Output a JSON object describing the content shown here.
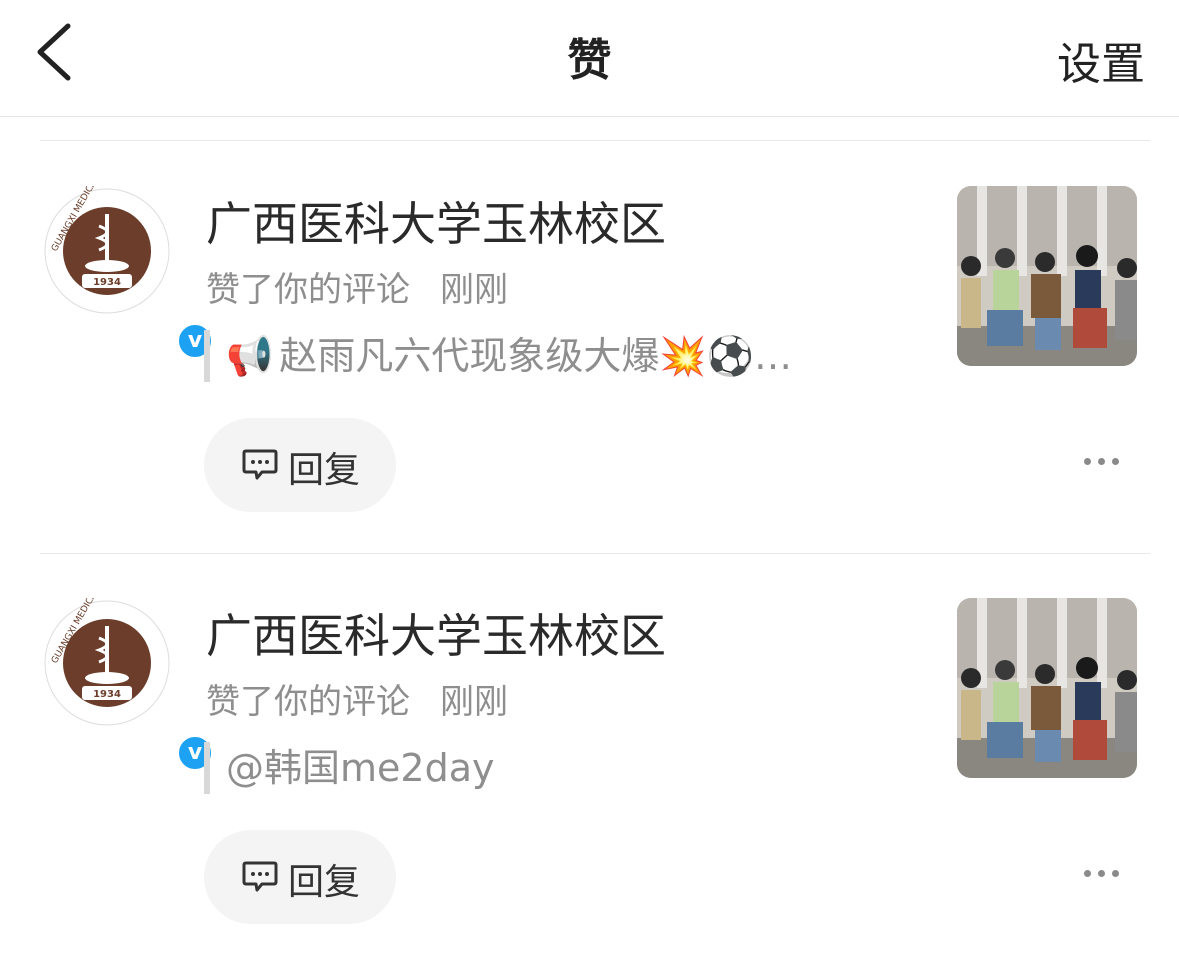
{
  "header": {
    "title": "赞",
    "settings_label": "设置"
  },
  "notifications": [
    {
      "user_name": "广西医科大学玉林校区",
      "avatar_year": "1934",
      "action": "赞了你的评论",
      "time": "刚刚",
      "quote_icon": "📢",
      "quote_text": "赵雨凡六代现象级大爆💥⚽…",
      "reply_label": "回复"
    },
    {
      "user_name": "广西医科大学玉林校区",
      "avatar_year": "1934",
      "action": "赞了你的评论",
      "time": "刚刚",
      "quote_icon": "",
      "quote_text": "@韩国me2day",
      "reply_label": "回复"
    }
  ],
  "colors": {
    "verified_badge": "#1da1f2",
    "avatar_brown": "#6b3d2a",
    "text_secondary": "#8e8e8e"
  }
}
